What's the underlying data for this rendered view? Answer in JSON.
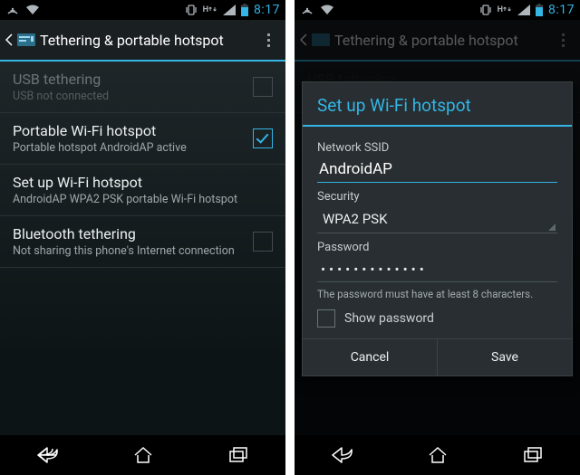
{
  "statusbar": {
    "time": "8:17"
  },
  "actionbar": {
    "title": "Tethering & portable hotspot"
  },
  "list": {
    "usb": {
      "title": "USB tethering",
      "subtitle": "USB not connected"
    },
    "wifi": {
      "title": "Portable Wi-Fi hotspot",
      "subtitle": "Portable hotspot AndroidAP active"
    },
    "setup": {
      "title": "Set up Wi-Fi hotspot",
      "subtitle": "AndroidAP WPA2 PSK portable Wi-Fi hotspot"
    },
    "bt": {
      "title": "Bluetooth tethering",
      "subtitle": "Not sharing this phone's Internet connection"
    }
  },
  "dialog": {
    "title": "Set up Wi-Fi hotspot",
    "ssid_label": "Network SSID",
    "ssid_value": "AndroidAP",
    "security_label": "Security",
    "security_value": "WPA2 PSK",
    "password_label": "Password",
    "password_masked": "•••••••••••••",
    "password_helper": "The password must have at least 8 characters.",
    "show_password_label": "Show password",
    "cancel_label": "Cancel",
    "save_label": "Save"
  }
}
